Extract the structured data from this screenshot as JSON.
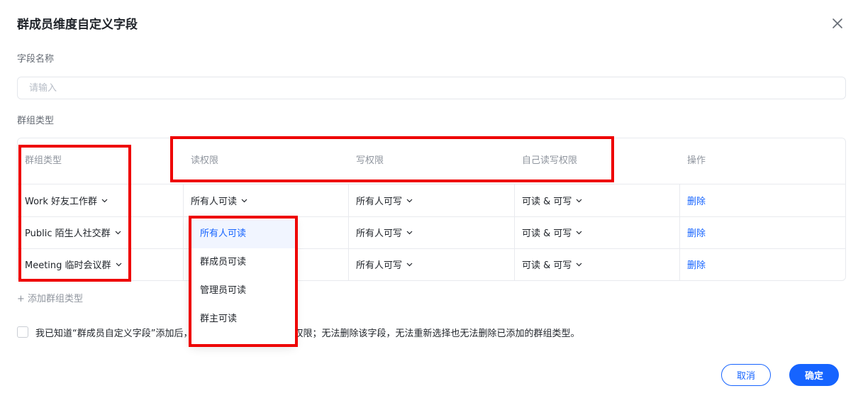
{
  "dialog": {
    "title": "群成员维度自定义字段",
    "field_name_label": "字段名称",
    "field_name_placeholder": "请输入",
    "group_type_label": "群组类型"
  },
  "table": {
    "headers": [
      "群组类型",
      "读权限",
      "写权限",
      "自己读写权限",
      "操作"
    ],
    "rows": [
      {
        "group": "Work 好友工作群",
        "read": "所有人可读",
        "write": "所有人可写",
        "self": "可读 & 可写",
        "action": "删除"
      },
      {
        "group": "Public 陌生人社交群",
        "read": "",
        "write": "所有人可写",
        "self": "可读 & 可写",
        "action": "删除"
      },
      {
        "group": "Meeting 临时会议群",
        "read": "",
        "write": "所有人可写",
        "self": "可读 & 可写",
        "action": "删除"
      }
    ],
    "add_label": "+ 添加群组类型"
  },
  "dropdown": {
    "options": [
      "所有人可读",
      "群成员可读",
      "管理员可读",
      "群主可读"
    ],
    "selected_index": 0
  },
  "agreement": {
    "checked": false,
    "text": "我已知道“群成员自定义字段”添加后，无法修改群组类型的读写权限；无法删除该字段，无法重新选择也无法删除已添加的群组类型。"
  },
  "footer": {
    "cancel_label": "取消",
    "ok_label": "确定"
  },
  "colors": {
    "primary": "#1664ff",
    "highlight": "#ee0000"
  }
}
